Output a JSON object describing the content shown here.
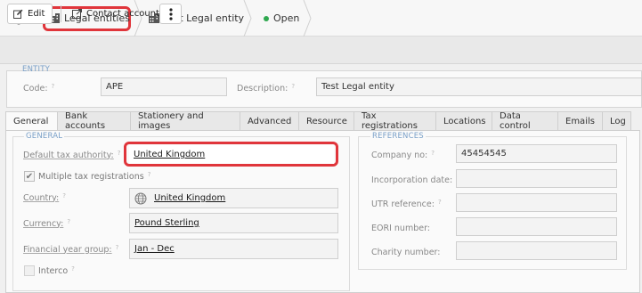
{
  "breadcrumb": {
    "items": [
      {
        "label": "Legal entities"
      },
      {
        "label": "Test Legal entity"
      },
      {
        "label": "Open"
      }
    ]
  },
  "toolbar": {
    "edit_label": "Edit",
    "contact_label": "Contact account"
  },
  "entity": {
    "section_title": "ENTITY",
    "code_label": "Code:",
    "code_value": "APE",
    "description_label": "Description:",
    "description_value": "Test Legal entity"
  },
  "tabs": [
    {
      "label": "General"
    },
    {
      "label": "Bank accounts"
    },
    {
      "label": "Stationery and images"
    },
    {
      "label": "Advanced"
    },
    {
      "label": "Resource"
    },
    {
      "label": "Tax registrations"
    },
    {
      "label": "Locations"
    },
    {
      "label": "Data control"
    },
    {
      "label": "Emails"
    },
    {
      "label": "Log"
    }
  ],
  "general": {
    "section_title": "GENERAL",
    "tax_authority_label": "Default tax authority:",
    "tax_authority_value": "United Kingdom",
    "multiple_tax_label": "Multiple tax registrations",
    "country_label": "Country:",
    "country_value": "United Kingdom",
    "currency_label": "Currency:",
    "currency_value": "Pound Sterling",
    "fy_group_label": "Financial year group:",
    "fy_group_value": "Jan - Dec",
    "interco_label": "Interco"
  },
  "references": {
    "section_title": "REFERENCES",
    "company_no_label": "Company no:",
    "company_no_value": "45454545",
    "incorporation_label": "Incorporation date:",
    "incorporation_value": "",
    "utr_label": "UTR reference:",
    "utr_value": "",
    "eori_label": "EORI number:",
    "eori_value": "",
    "charity_label": "Charity number:",
    "charity_value": ""
  },
  "colors": {
    "highlight": "#e0353b",
    "status_open": "#2fa84f",
    "section_title": "#7aa0c8"
  }
}
